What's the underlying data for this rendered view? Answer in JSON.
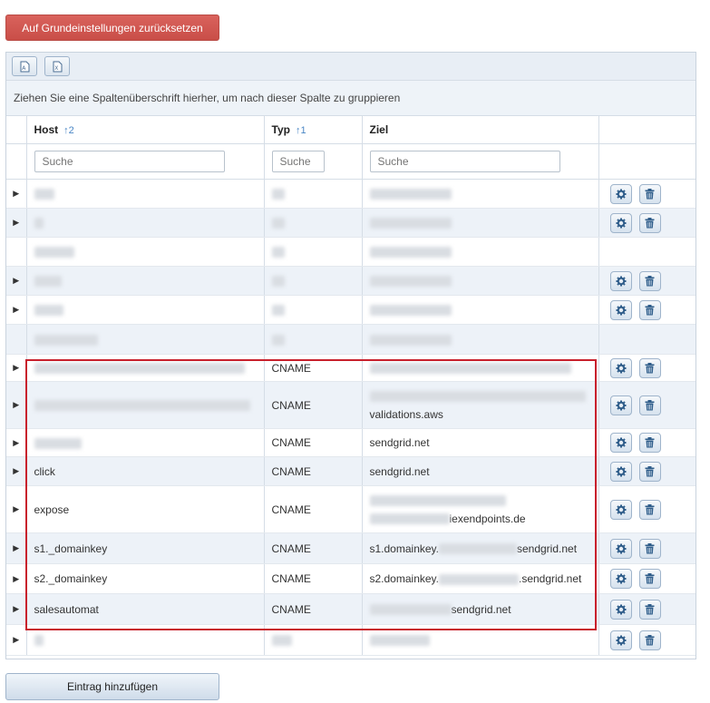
{
  "reset_button": "Auf Grundeinstellungen zurücksetzen",
  "add_button": "Eintrag hinzufügen",
  "toolbar": {
    "pdf_icon": "pdf-export-icon",
    "excel_icon": "excel-export-icon"
  },
  "group_hint": "Ziehen Sie eine Spaltenüberschrift hierher, um nach dieser Spalte zu gruppieren",
  "columns": {
    "host": {
      "label": "Host",
      "sort": "↑2"
    },
    "typ": {
      "label": "Typ",
      "sort": "↑1"
    },
    "ziel": {
      "label": "Ziel"
    }
  },
  "search_placeholder": "Suche",
  "rows": [
    {
      "host": "",
      "typ": "",
      "ziel": "",
      "ziel2": ""
    },
    {
      "host": "",
      "typ": "",
      "ziel": "",
      "ziel2": ""
    },
    {
      "host": "",
      "typ": "",
      "ziel": "",
      "ziel2": ""
    },
    {
      "host": "",
      "typ": "",
      "ziel": "",
      "ziel2": ""
    },
    {
      "host": "",
      "typ": "",
      "ziel": "",
      "ziel2": ""
    },
    {
      "host": "",
      "typ": "",
      "ziel": "",
      "ziel2": ""
    },
    {
      "host": "",
      "typ": "CNAME",
      "ziel": "",
      "ziel2": ""
    },
    {
      "host": "",
      "typ": "CNAME",
      "ziel": "",
      "ziel2": "validations.aws"
    },
    {
      "host": "",
      "typ": "CNAME",
      "ziel": "sendgrid.net",
      "ziel2": ""
    },
    {
      "host": "click",
      "typ": "CNAME",
      "ziel": "sendgrid.net",
      "ziel2": ""
    },
    {
      "host": "expose",
      "typ": "CNAME",
      "ziel": "",
      "ziel2": "iexendpoints.de"
    },
    {
      "host": "s1._domainkey",
      "typ": "CNAME",
      "ziel": "s1.domainkey.",
      "ziel2": "sendgrid.net"
    },
    {
      "host": "s2._domainkey",
      "typ": "CNAME",
      "ziel": "s2.domainkey.",
      "ziel2": ".sendgrid.net"
    },
    {
      "host": "salesautomat",
      "typ": "CNAME",
      "ziel": "",
      "ziel2": "sendgrid.net"
    },
    {
      "host": "",
      "typ": "",
      "ziel": "",
      "ziel2": ""
    }
  ]
}
